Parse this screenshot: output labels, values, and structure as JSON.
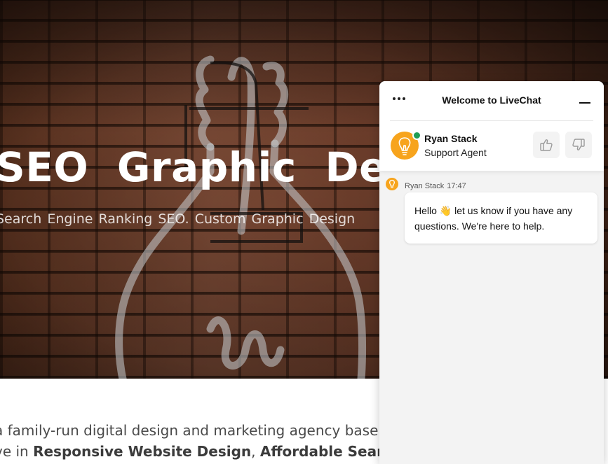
{
  "hero": {
    "title": "SEO   Graphic Desig",
    "subtitle": "Search Engine Ranking SEO.  Custom Graphic Design"
  },
  "body": {
    "line1": "a family-run digital design and marketing agency base",
    "line2_prefix": "ve in ",
    "line2_bold1": "Responsive Website Design",
    "line2_sep": ", ",
    "line2_bold2": "Affordable Search En"
  },
  "chat": {
    "title": "Welcome to LiveChat",
    "menu_icon": "more-dots-icon",
    "minimize_icon": "minimize-icon",
    "agent": {
      "name": "Ryan Stack",
      "role": "Support Agent",
      "avatar_icon": "lightbulb-icon",
      "status": "online"
    },
    "rating": {
      "up_icon": "thumbs-up-icon",
      "down_icon": "thumbs-down-icon"
    },
    "message": {
      "author": "Ryan Stack",
      "time": "17:47",
      "text_before": "Hello ",
      "emoji": "👋",
      "text_after": " let us know if you have any questions. We're here to help."
    }
  },
  "colors": {
    "accent": "#f7a41d",
    "online": "#1f9d55",
    "hero_brick": "#7a4530"
  }
}
